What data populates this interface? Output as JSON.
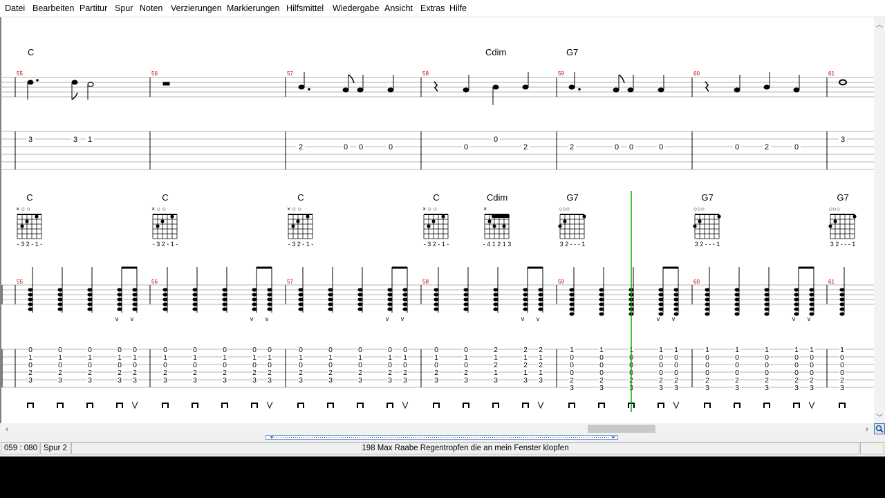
{
  "menu": [
    "Datei",
    "Bearbeiten",
    "Partitur",
    "Spur",
    "Noten",
    "Verzierungen",
    "Markierungen",
    "Hilfsmittel",
    "Wiedergabe",
    "Ansicht",
    "Extras",
    "Hilfe"
  ],
  "measure_numbers": [
    "55",
    "56",
    "57",
    "58",
    "59",
    "60",
    "61"
  ],
  "system1": {
    "chords": [
      "C",
      "Cdim",
      "G7"
    ],
    "tab_rows": [
      [
        "3",
        "3",
        "1"
      ],
      [],
      [
        "2",
        "0",
        "0",
        "0"
      ],
      [
        "0",
        "0",
        "2"
      ],
      [
        "2",
        "0",
        "0",
        "0"
      ],
      [
        "0",
        "2",
        "0"
      ],
      [
        "3"
      ]
    ]
  },
  "system2": {
    "chord_diagrams": [
      {
        "name": "C",
        "top": "×  ○ ○",
        "fingering": "- 3 2 - 1 -"
      },
      {
        "name": "C",
        "top": "×  ○ ○",
        "fingering": "- 3 2 - 1 -"
      },
      {
        "name": "C",
        "top": "×  ○ ○",
        "fingering": "- 3 2 - 1 -"
      },
      {
        "name": "C",
        "top": "×  ○ ○",
        "fingering": "- 3 2 - 1 -"
      },
      {
        "name": "Cdim",
        "top": "×",
        "fingering": "- 4 1 2 1 3"
      },
      {
        "name": "G7",
        "top": "○○○",
        "fingering": "3 2 - - - 1"
      },
      {
        "name": "G7",
        "top": "○○○",
        "fingering": "3 2 - - - 1"
      },
      {
        "name": "G7",
        "top": "○○○",
        "fingering": "3 2 - - - 1"
      }
    ],
    "tab_chord_columns": {
      "C": [
        "0",
        "1",
        "0",
        "2",
        "3"
      ],
      "Cdim": [
        "2",
        "1",
        "2",
        "1",
        "3"
      ],
      "G7": [
        "1",
        "0",
        "0",
        "0",
        "2",
        "3"
      ]
    }
  },
  "status": {
    "position": "059 : 080",
    "track": "Spur 2",
    "song": "198  Max Raabe  Regentropfen die an mein Fenster klopfen"
  }
}
